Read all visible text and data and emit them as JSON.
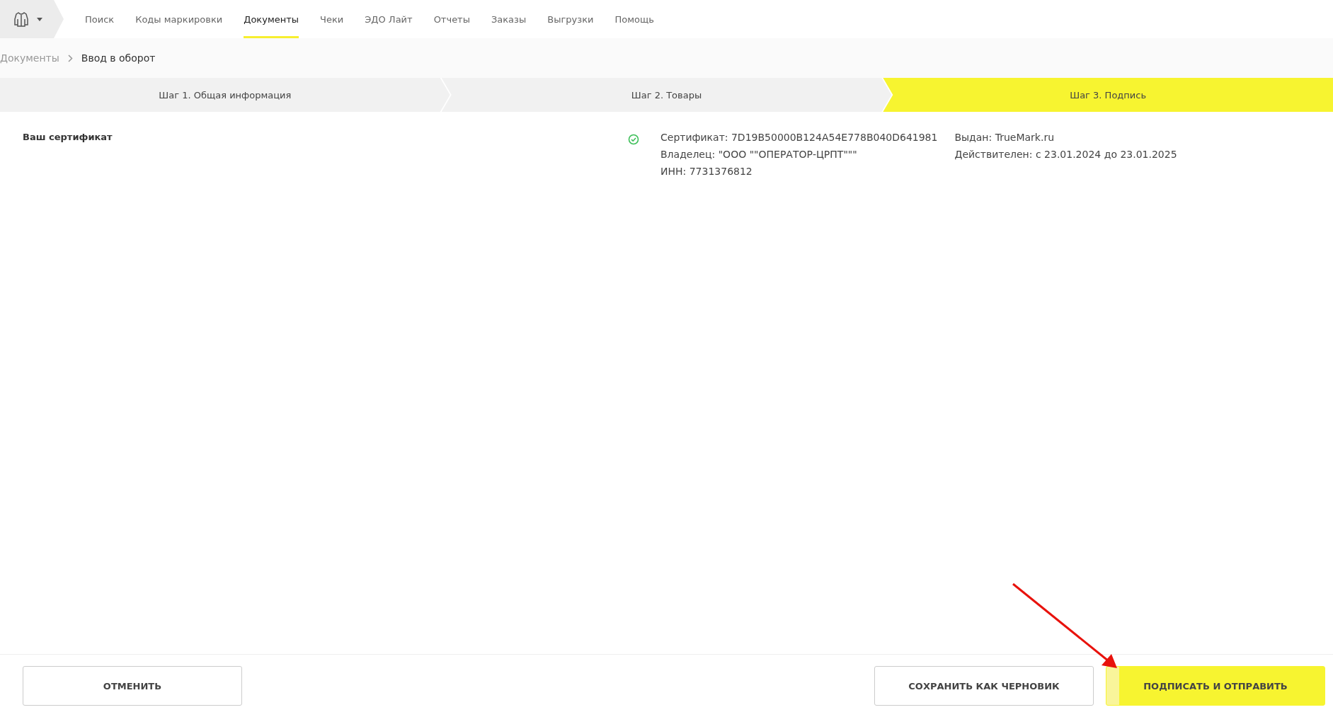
{
  "nav": {
    "items": [
      {
        "label": "Поиск",
        "selected": false
      },
      {
        "label": "Коды маркировки",
        "selected": false
      },
      {
        "label": "Документы",
        "selected": true
      },
      {
        "label": "Чеки",
        "selected": false
      },
      {
        "label": "ЭДО Лайт",
        "selected": false
      },
      {
        "label": "Отчеты",
        "selected": false
      },
      {
        "label": "Заказы",
        "selected": false
      },
      {
        "label": "Выгрузки",
        "selected": false
      },
      {
        "label": "Помощь",
        "selected": false
      }
    ]
  },
  "breadcrumb": [
    {
      "label": "Документы",
      "current": false
    },
    {
      "label": "Ввод в оборот",
      "current": true
    }
  ],
  "steps": [
    {
      "label": "Шаг 1. Общая информация",
      "selected": false
    },
    {
      "label": "Шаг 2. Товары",
      "selected": false
    },
    {
      "label": "Шаг 3. Подпись",
      "selected": true
    }
  ],
  "certificate": {
    "label": "Ваш сертификат",
    "valid": true,
    "details": [
      "Сертификат: 7D19B50000B124A54E778B040D641981",
      "Владелец: \"ООО \"\"ОПЕРАТОР-ЦРПТ\"\"\"",
      "ИНН: 7731376812"
    ],
    "issuer": [
      "Выдан: TrueMark.ru",
      "Действителен: с 23.01.2024 до 23.01.2025"
    ]
  },
  "buttons": [
    {
      "label": "ОТМЕНИТЬ",
      "kind": "secondary"
    },
    {
      "label": "СОХРАНИТЬ КАК ЧЕРНОВИК",
      "kind": "secondary"
    },
    {
      "label": "ПОДПИСАТЬ И ОТПРАВИТЬ",
      "kind": "primary"
    }
  ]
}
